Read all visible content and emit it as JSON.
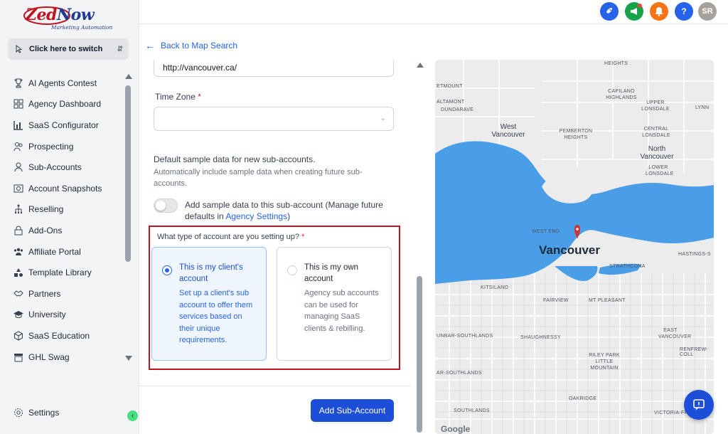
{
  "logo": {
    "brand_z": "Zed",
    "brand_rest": "Now",
    "tagline": "Marketing Automation"
  },
  "switcher": {
    "label": "Click here to switch"
  },
  "sidebar": {
    "items": [
      {
        "label": "AI Agents Contest",
        "icon": "trophy-icon"
      },
      {
        "label": "Agency Dashboard",
        "icon": "dashboard-icon"
      },
      {
        "label": "SaaS Configurator",
        "icon": "chart-bar-icon"
      },
      {
        "label": "Prospecting",
        "icon": "users-icon"
      },
      {
        "label": "Sub-Accounts",
        "icon": "user-icon"
      },
      {
        "label": "Account Snapshots",
        "icon": "snapshot-icon"
      },
      {
        "label": "Reselling",
        "icon": "tree-icon"
      },
      {
        "label": "Add-Ons",
        "icon": "lock-icon"
      },
      {
        "label": "Affiliate Portal",
        "icon": "group-icon"
      },
      {
        "label": "Template Library",
        "icon": "shapes-icon"
      },
      {
        "label": "Partners",
        "icon": "handshake-icon"
      },
      {
        "label": "University",
        "icon": "graduation-icon"
      },
      {
        "label": "SaaS Education",
        "icon": "cube-icon"
      },
      {
        "label": "GHL Swag",
        "icon": "store-icon"
      }
    ],
    "settings_label": "Settings"
  },
  "header": {
    "avatar_initials": "SR",
    "help_label": "?",
    "colors": {
      "blue": "#2563eb",
      "green": "#16a34a",
      "orange": "#f97316",
      "avatar": "#a8a29e"
    }
  },
  "main": {
    "back_label": "Back to Map Search",
    "website_value": "http://vancouver.ca/",
    "timezone": {
      "label": "Time Zone",
      "required_mark": "*",
      "value": ""
    },
    "sample_data": {
      "title": "Default sample data for new sub-accounts.",
      "description": "Automatically include sample data when creating future sub-accounts.",
      "toggle_text": "Add sample data to this sub-account (Manage future defaults in ",
      "toggle_link": "Agency Settings",
      "toggle_text_end": ")",
      "enabled": false
    },
    "account_type": {
      "question": "What type of account are you setting up?",
      "required_mark": "*",
      "options": [
        {
          "title": "This is my client's account",
          "description": "Set up a client's sub account to offer them services based on their unique requirements.",
          "selected": true
        },
        {
          "title": "This is my own account",
          "description": "Agency sub accounts can be used for managing SaaS clients & rebilling.",
          "selected": false
        }
      ]
    },
    "submit_label": "Add Sub-Account"
  },
  "map": {
    "city_label": "Vancouver",
    "labels": [
      "HEIGHTS",
      "CAPILANO HIGHLANDS",
      "UPPER LONSDALE",
      "LYNN",
      "ALTAMONT",
      "DUNDARAVE",
      "West Vancouver",
      "PEMBERTON HEIGHTS",
      "CENTRAL LONSDALE",
      "North Vancouver",
      "LOWER LONSDALE",
      "WEST END",
      "HASTINGS-S",
      "STRATHCONA",
      "KITSILANO",
      "FAIRVIEW",
      "MT PLEASANT",
      "UNBAR-SOUTHLANDS",
      "SHAUGHNESSY",
      "EAST VANCOUVER",
      "RENFREW-COLL",
      "RILEY PARK LITTLE MOUNTAIN",
      "AR-SOUTHLANDS",
      "OAKRIDGE",
      "SOUTHLANDS",
      "VICTORIA-FRASER",
      "ETMOUNT"
    ],
    "attribution": "Google",
    "colors": {
      "water": "#4a9ee8",
      "land": "#ececec",
      "marker": "#d32f2f"
    }
  }
}
